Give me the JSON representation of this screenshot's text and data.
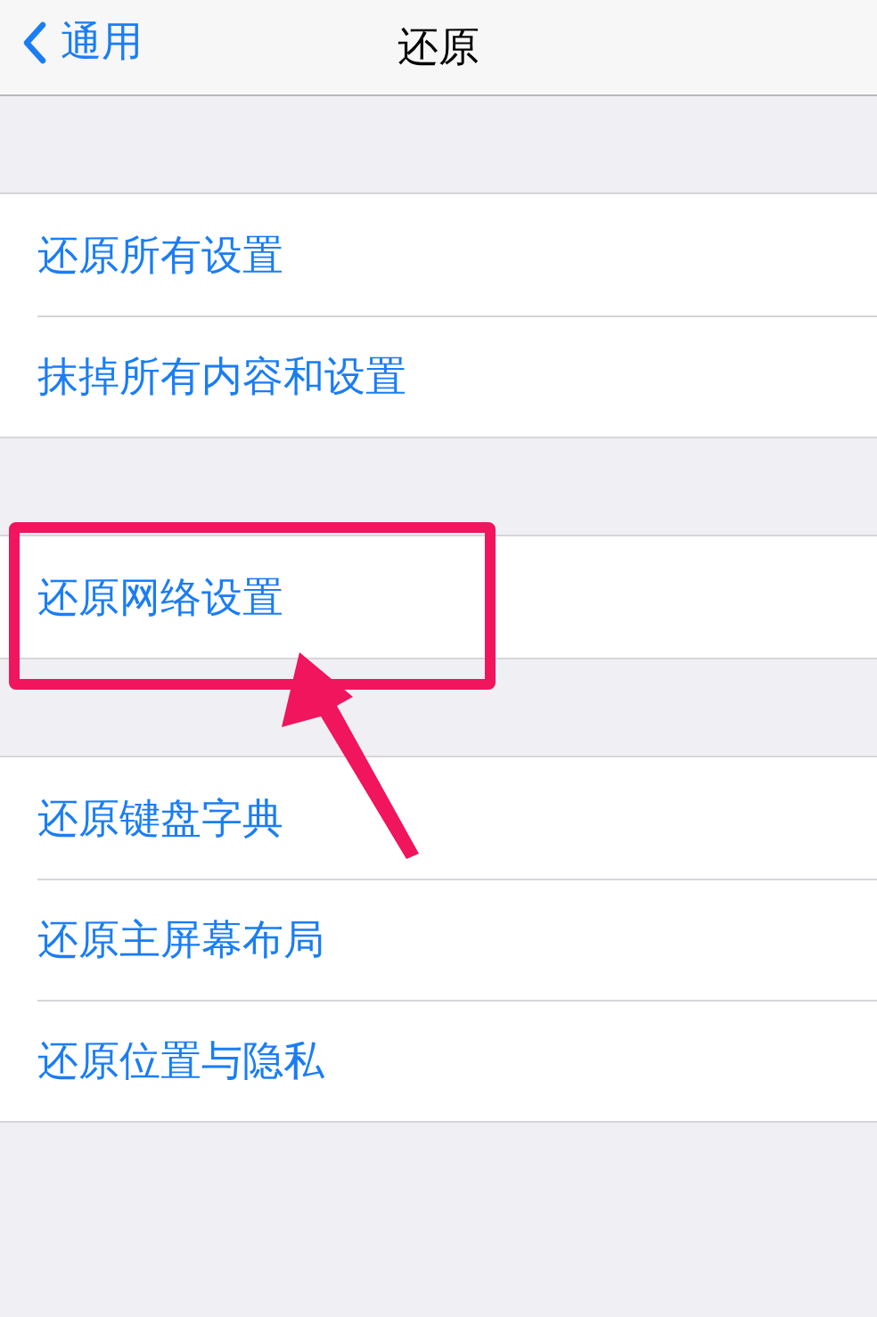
{
  "nav_bar": {
    "back_label": "通用",
    "title": "还原"
  },
  "groups": [
    {
      "items": [
        {
          "label": "还原所有设置",
          "highlighted": false
        },
        {
          "label": "抹掉所有内容和设置",
          "highlighted": false
        }
      ]
    },
    {
      "items": [
        {
          "label": "还原网络设置",
          "highlighted": true
        }
      ]
    },
    {
      "items": [
        {
          "label": "还原键盘字典",
          "highlighted": false
        },
        {
          "label": "还原主屏幕布局",
          "highlighted": false
        },
        {
          "label": "还原位置与隐私",
          "highlighted": false
        }
      ]
    }
  ]
}
